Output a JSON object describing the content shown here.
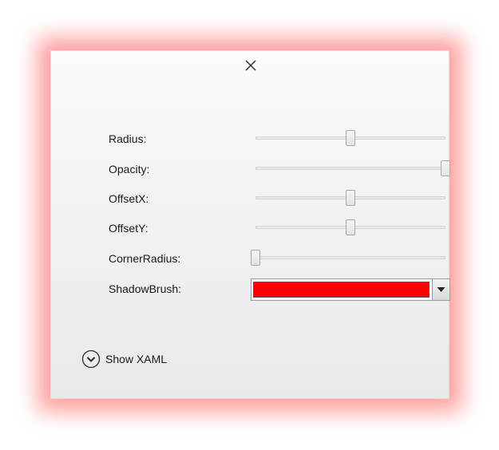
{
  "dialog": {
    "close_icon": "close-icon"
  },
  "settings": {
    "sliders": [
      {
        "key": "radius",
        "label": "Radius:",
        "value": 0.5
      },
      {
        "key": "opacity",
        "label": "Opacity:",
        "value": 1.0
      },
      {
        "key": "offset-x",
        "label": "OffsetX:",
        "value": 0.5
      },
      {
        "key": "offset-y",
        "label": "OffsetY:",
        "value": 0.5
      },
      {
        "key": "corner-radius",
        "label": "CornerRadius:",
        "value": 0.0
      }
    ],
    "shadow_brush": {
      "label": "ShadowBrush:",
      "color": "#FF0000",
      "dropdown_icon": "chevron-down-icon"
    }
  },
  "footer": {
    "show_xaml_label": "Show XAML",
    "show_xaml_icon": "circle-chevron-down-icon"
  },
  "colors": {
    "window_glow": "#FF0000"
  }
}
